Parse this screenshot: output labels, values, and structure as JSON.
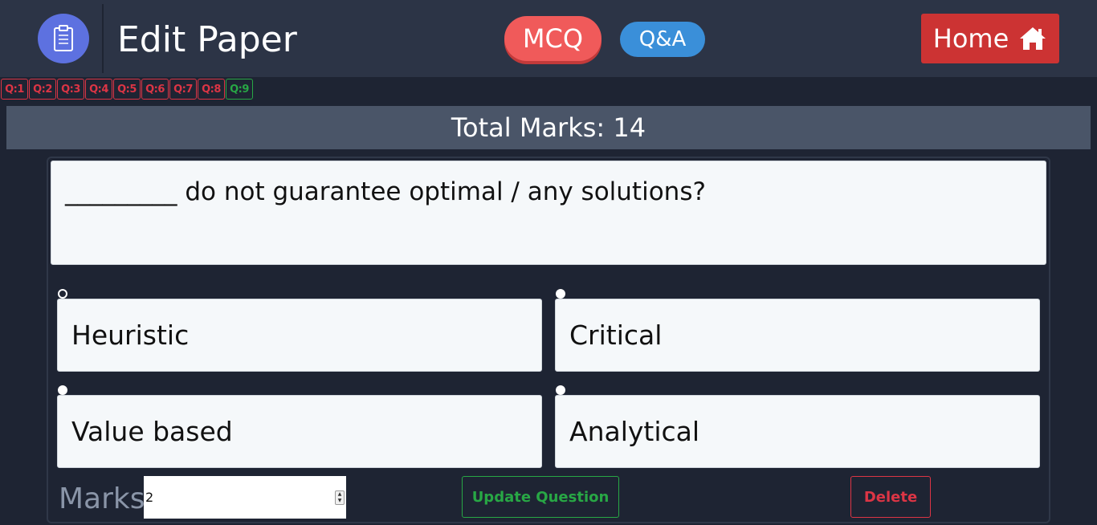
{
  "header": {
    "title": "Edit Paper",
    "logo_icon": "clipboard-icon",
    "mcq_label": "MCQ",
    "qa_label": "Q&A",
    "home_label": "Home",
    "home_icon": "home-icon",
    "colors": {
      "logo_bg": "#5d71e0",
      "mcq_bg": "#f05a5a",
      "qa_bg": "#3a8fd9",
      "home_bg": "#cc3333"
    }
  },
  "question_nav": [
    {
      "label": "Q:1",
      "active": false
    },
    {
      "label": "Q:2",
      "active": false
    },
    {
      "label": "Q:3",
      "active": false
    },
    {
      "label": "Q:4",
      "active": false
    },
    {
      "label": "Q:5",
      "active": false
    },
    {
      "label": "Q:6",
      "active": false
    },
    {
      "label": "Q:7",
      "active": false
    },
    {
      "label": "Q:8",
      "active": false
    },
    {
      "label": "Q:9",
      "active": true
    }
  ],
  "total_marks": "Total Marks: 14",
  "question": {
    "text": "_________ do not guarantee optimal / any solutions?",
    "options": [
      {
        "label": "Heuristic",
        "selected": true
      },
      {
        "label": "Critical",
        "selected": false
      },
      {
        "label": "Value based",
        "selected": false
      },
      {
        "label": "Analytical",
        "selected": false
      }
    ]
  },
  "form": {
    "marks_label": "Marks",
    "marks_value": "2",
    "update_label": "Update Question",
    "delete_label": "Delete"
  }
}
